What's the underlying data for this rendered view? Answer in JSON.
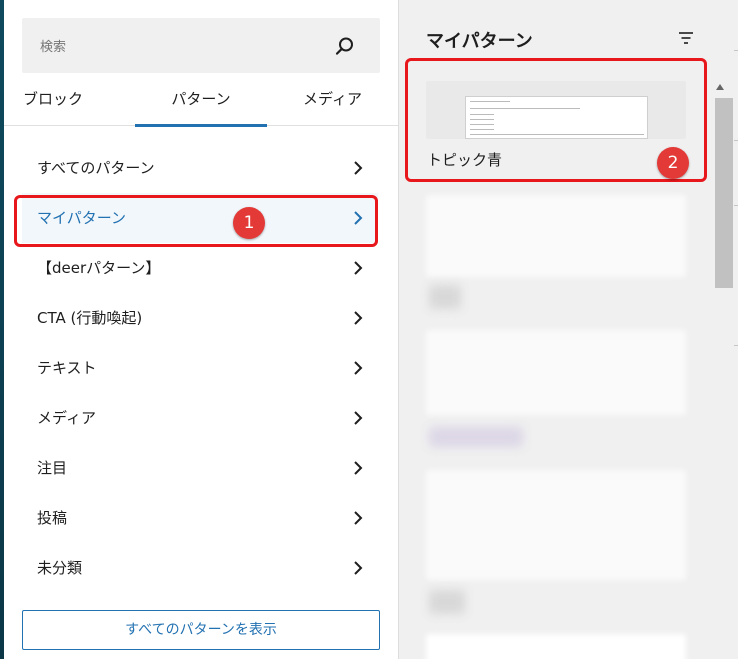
{
  "search": {
    "placeholder": "検索"
  },
  "tabs": [
    {
      "label": "ブロック",
      "active": false
    },
    {
      "label": "パターン",
      "active": true
    },
    {
      "label": "メディア",
      "active": false
    }
  ],
  "categories": [
    {
      "label": "すべてのパターン",
      "selected": false
    },
    {
      "label": "マイパターン",
      "selected": true
    },
    {
      "label": "【deerパターン】",
      "selected": false
    },
    {
      "label": "CTA (行動喚起)",
      "selected": false
    },
    {
      "label": "テキスト",
      "selected": false
    },
    {
      "label": "メディア",
      "selected": false
    },
    {
      "label": "注目",
      "selected": false
    },
    {
      "label": "投稿",
      "selected": false
    },
    {
      "label": "未分類",
      "selected": false
    }
  ],
  "show_all_button": "すべてのパターンを表示",
  "right_panel": {
    "title": "マイパターン",
    "pattern_name": "トピック青"
  },
  "markers": [
    "1",
    "2"
  ],
  "colors": {
    "accent": "#2271b1",
    "highlight": "#e8171c",
    "marker": "#e33a37"
  }
}
